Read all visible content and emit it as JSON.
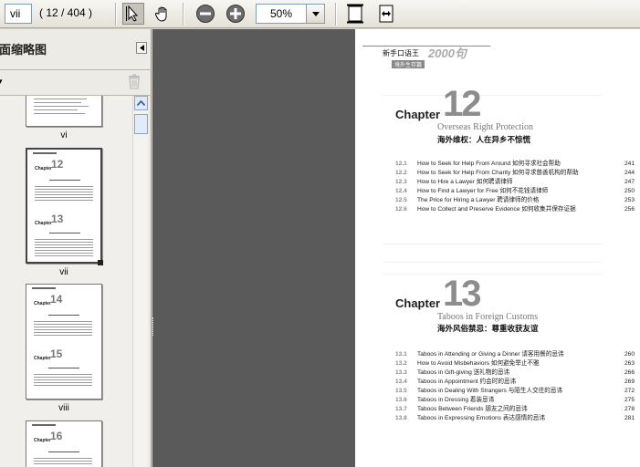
{
  "toolbar": {
    "page_field": "vii",
    "page_count": "( 12 / 404 )",
    "zoom_value": "50%"
  },
  "sidebar": {
    "title": "页面缩略图",
    "options_label": "▾",
    "thumbnails": [
      {
        "label": "vi"
      },
      {
        "label": "vii",
        "chapters": [
          {
            "word": "Chapter",
            "num": "12"
          },
          {
            "word": "Chapter",
            "num": "13"
          }
        ]
      },
      {
        "label": "viii",
        "chapters": [
          {
            "word": "Chapter",
            "num": "14"
          },
          {
            "word": "Chapter",
            "num": "15"
          }
        ]
      },
      {
        "label": "",
        "chapters": [
          {
            "word": "Chapter",
            "num": "16"
          }
        ]
      }
    ]
  },
  "page": {
    "header": {
      "brand": "新手口语王",
      "brand_num": "2000句",
      "tag": "境外生存篇"
    },
    "chapters": [
      {
        "word": "Chapter",
        "number": "12",
        "title_en": "Overseas Right Protection",
        "title_cn": "海外维权：人在异乡不惊慌",
        "items": [
          {
            "n": "12.1",
            "t": "How to Seek for Help From Around 如何寻求社会帮助",
            "p": "241"
          },
          {
            "n": "12.2",
            "t": "How to Seek for Help From Charity 如何寻求慈善机构的帮助",
            "p": "244"
          },
          {
            "n": "12.3",
            "t": "How to Hire a Lawyer 如何聘请律师",
            "p": "247"
          },
          {
            "n": "12.4",
            "t": "How to Find a Lawyer for Free 如何不花钱请律师",
            "p": "250"
          },
          {
            "n": "12.5",
            "t": "The Price for Hiring a Lawyer 聘请律师的价格",
            "p": "253"
          },
          {
            "n": "12.6",
            "t": "How to Collect and Preserve Evidence 如何收集并保存证据",
            "p": "256"
          }
        ]
      },
      {
        "word": "Chapter",
        "number": "13",
        "title_en": "Taboos in Foreign Customs",
        "title_cn": "海外风俗禁忌：尊重收获友谊",
        "items": [
          {
            "n": "13.1",
            "t": "Taboos in Attending or Giving a Dinner 请客用餐的忌讳",
            "p": "260"
          },
          {
            "n": "13.2",
            "t": "How to Avoid Misbehaviors 如何避免举止不雅",
            "p": "263"
          },
          {
            "n": "13.3",
            "t": "Taboos in Gift-giving 送礼物的忌讳",
            "p": "266"
          },
          {
            "n": "13.4",
            "t": "Taboos in Appointment 约会时的忌讳",
            "p": "269"
          },
          {
            "n": "13.5",
            "t": "Taboos in Dealing With Strangers 与陌生人交往的忌讳",
            "p": "272"
          },
          {
            "n": "13.6",
            "t": "Taboos in Dressing 着装忌讳",
            "p": "275"
          },
          {
            "n": "13.7",
            "t": "Taboos Between Friends 朋友之间的忌讳",
            "p": "278"
          },
          {
            "n": "13.8",
            "t": "Taboos in Expressing Emotions 表达感情的忌讳",
            "p": "281"
          }
        ]
      }
    ]
  }
}
